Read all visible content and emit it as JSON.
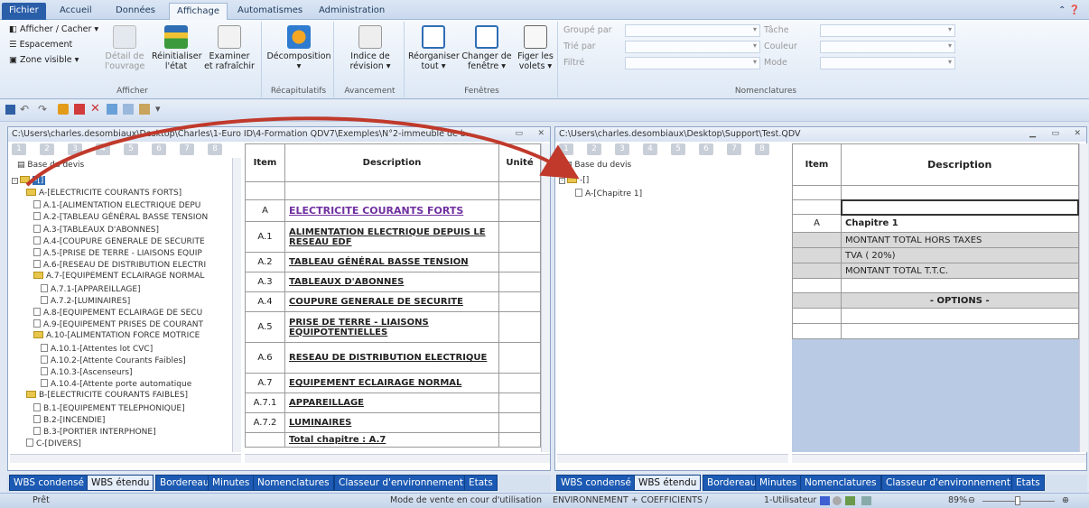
{
  "ribbon_tabs": [
    "Fichier",
    "Accueil",
    "Données",
    "Affichage",
    "Automatismes",
    "Administration"
  ],
  "ribbon": {
    "afficher": {
      "show_hide": "Afficher / Cacher",
      "spacing": "Espacement",
      "visible_zone": "Zone visible",
      "detail1": "Détail de",
      "detail2": "l'ouvrage",
      "reset1": "Réinitialiser",
      "reset2": "l'état",
      "examine1": "Examiner",
      "examine2": "et rafraîchir",
      "label": "Afficher"
    },
    "recap": {
      "btn": "Décomposition",
      "label": "Récapitulatifs"
    },
    "avancement": {
      "btn1": "Indice de",
      "btn2": "révision",
      "label": "Avancement"
    },
    "fenetres": {
      "reorg1": "Réorganiser",
      "reorg2": "tout",
      "change1": "Changer de",
      "change2": "fenêtre",
      "freeze1": "Figer les",
      "freeze2": "volets",
      "label": "Fenêtres"
    },
    "nomen": {
      "group_by": "Groupé par",
      "sort_by": "Trié par",
      "filter": "Filtré",
      "task": "Tâche",
      "color": "Couleur",
      "mode": "Mode",
      "label": "Nomenclatures"
    }
  },
  "levels": [
    "1",
    "2",
    "3",
    "4",
    "5",
    "6",
    "7",
    "8"
  ],
  "left": {
    "title": "C:\\Users\\charles.desombiaux\\Desktop\\Charles\\1-Euro ID\\4-Formation QDV7\\Exemples\\N°2-immeuble de b...",
    "tree_root": "Base du devis",
    "tree": [
      "A-[ELECTRICITE COURANTS FORTS]",
      "A.1-[ALIMENTATION ELECTRIQUE DEPU",
      "A.2-[TABLEAU GÉNÉRAL BASSE TENSION",
      "A.3-[TABLEAUX D'ABONNES]",
      "A.4-[COUPURE GENERALE DE SECURITE",
      "A.5-[PRISE DE TERRE - LIAISONS EQUIP",
      "A.6-[RESEAU DE DISTRIBUTION ELECTRI",
      "A.7-[EQUIPEMENT ECLAIRAGE NORMAL",
      "A.7.1-[APPAREILLAGE]",
      "A.7.2-[LUMINAIRES]",
      "A.8-[EQUIPEMENT ECLAIRAGE DE SECU",
      "A.9-[EQUIPEMENT PRISES DE COURANT",
      "A.10-[ALIMENTATION FORCE MOTRICE",
      "A.10.1-[Attentes lot CVC]",
      "A.10.2-[Attente Courants Faibles]",
      "A.10.3-[Ascenseurs]",
      "A.10.4-[Attente porte automatique",
      "B-[ELECTRICITE COURANTS FAIBLES]",
      "B.1-[EQUIPEMENT TELEPHONIQUE]",
      "B.2-[INCENDIE]",
      "B.3-[PORTIER INTERPHONE]",
      "C-[DIVERS]"
    ],
    "cols": {
      "item": "Item",
      "desc": "Description",
      "unit": "Unité"
    },
    "rows": [
      [
        "",
        ""
      ],
      [
        "A",
        "ELECTRICITE COURANTS FORTS"
      ],
      [
        "A.1",
        "ALIMENTATION ELECTRIQUE DEPUIS LE RESEAU EDF"
      ],
      [
        "A.2",
        "TABLEAU GÉNÉRAL BASSE TENSION"
      ],
      [
        "A.3",
        "TABLEAUX D'ABONNES"
      ],
      [
        "A.4",
        "COUPURE GENERALE DE SECURITE"
      ],
      [
        "A.5",
        "PRISE DE TERRE - LIAISONS EQUIPOTENTIELLES"
      ],
      [
        "A.6",
        "RESEAU DE DISTRIBUTION ELECTRIQUE"
      ],
      [
        "A.7",
        "EQUIPEMENT ECLAIRAGE NORMAL"
      ],
      [
        "A.7.1",
        "APPAREILLAGE"
      ],
      [
        "A.7.2",
        "LUMINAIRES"
      ],
      [
        "",
        "Total chapitre : A.7"
      ]
    ]
  },
  "right": {
    "title": "C:\\Users\\charles.desombiaux\\Desktop\\Support\\Test.QDV",
    "tree_root": "Base du devis",
    "tree_sub": "-[]",
    "tree_leaf": "A-[Chapitre 1]",
    "cols": {
      "item": "Item",
      "desc": "Description"
    },
    "rows": [
      [
        "",
        ""
      ],
      [
        "",
        ""
      ],
      [
        "A",
        "Chapitre 1"
      ],
      [
        "",
        "MONTANT TOTAL HORS TAXES"
      ],
      [
        "",
        "TVA ( 20%)"
      ],
      [
        "",
        "MONTANT TOTAL T.T.C."
      ],
      [
        "",
        ""
      ],
      [
        "",
        "- OPTIONS -"
      ],
      [
        "",
        ""
      ],
      [
        "",
        ""
      ]
    ]
  },
  "bottom_tabs": [
    "WBS condensé",
    "WBS étendu",
    "Bordereau",
    "Minutes",
    "Nomenclatures",
    "Classeur d'environnement",
    "Etats"
  ],
  "status": {
    "ready": "Prêt",
    "mode": "Mode de vente en cour d'utilisation",
    "env": "ENVIRONNEMENT + COEFFICIENTS /",
    "user": "1-Utilisateur",
    "zoom": "89%"
  },
  "colors": {
    "accent": "#1c5ab3",
    "purple_link": "#7030a0",
    "arrow": "#c0392b",
    "table_blue": "#b9cbe4"
  }
}
